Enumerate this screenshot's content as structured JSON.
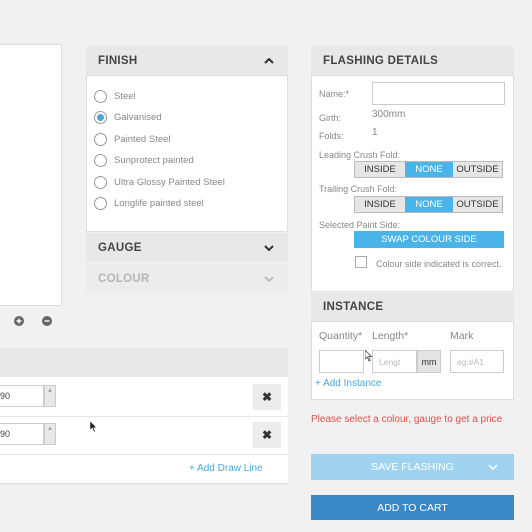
{
  "left": {
    "zoom_in_icon": "plus-circle-icon",
    "zoom_out_icon": "minus-circle-icon",
    "rows": [
      {
        "value": "90",
        "spinner": "▴"
      },
      {
        "value": "90",
        "spinner": "▴"
      }
    ],
    "delete_glyph": "✖",
    "add_draw_line": "+ Add Draw Line"
  },
  "finish": {
    "title": "FINISH",
    "options": [
      "Steel",
      "Galvanised",
      "Painted Steel",
      "Sunprotect painted",
      "Ultra Glossy Painted Steel",
      "Longlife painted steel"
    ],
    "selected_index": 1
  },
  "gauge": {
    "title": "GAUGE"
  },
  "colour": {
    "title": "COLOUR"
  },
  "flashing": {
    "title": "FLASHING DETAILS",
    "name_label": "Name:*",
    "name_value": "",
    "girth_label": "Girth:",
    "girth_value": "300mm",
    "folds_label": "Folds:",
    "folds_value": "1",
    "leading_label": "Leading Crush Fold:",
    "leading_options": [
      "INSIDE",
      "NONE",
      "OUTSIDE"
    ],
    "leading_selected": 1,
    "trailing_label": "Trailing Crush Fold:",
    "trailing_options": [
      "INSIDE",
      "NONE",
      "OUTSIDE"
    ],
    "trailing_selected": 1,
    "paint_side_label": "Selected Paint Side:",
    "swap_label": "SWAP COLOUR SIDE",
    "confirm_label": "Colour side indicated is correct."
  },
  "instance": {
    "title": "INSTANCE",
    "quantity_label": "Quantity*",
    "length_label": "Length*",
    "mark_label": "Mark",
    "length_placeholder": "Lengt",
    "length_unit": "mm",
    "mark_placeholder": "eg:#A1",
    "add_instance": "+ Add Instance"
  },
  "error_message": "Please select a colour, gauge to get a price",
  "save_flashing": "SAVE FLASHING",
  "add_to_cart": "ADD TO CART",
  "colors": {
    "accent": "#4ab4e8",
    "error": "#d9534f",
    "cart": "#3a87c8",
    "save_disabled": "#9fd3f0"
  }
}
